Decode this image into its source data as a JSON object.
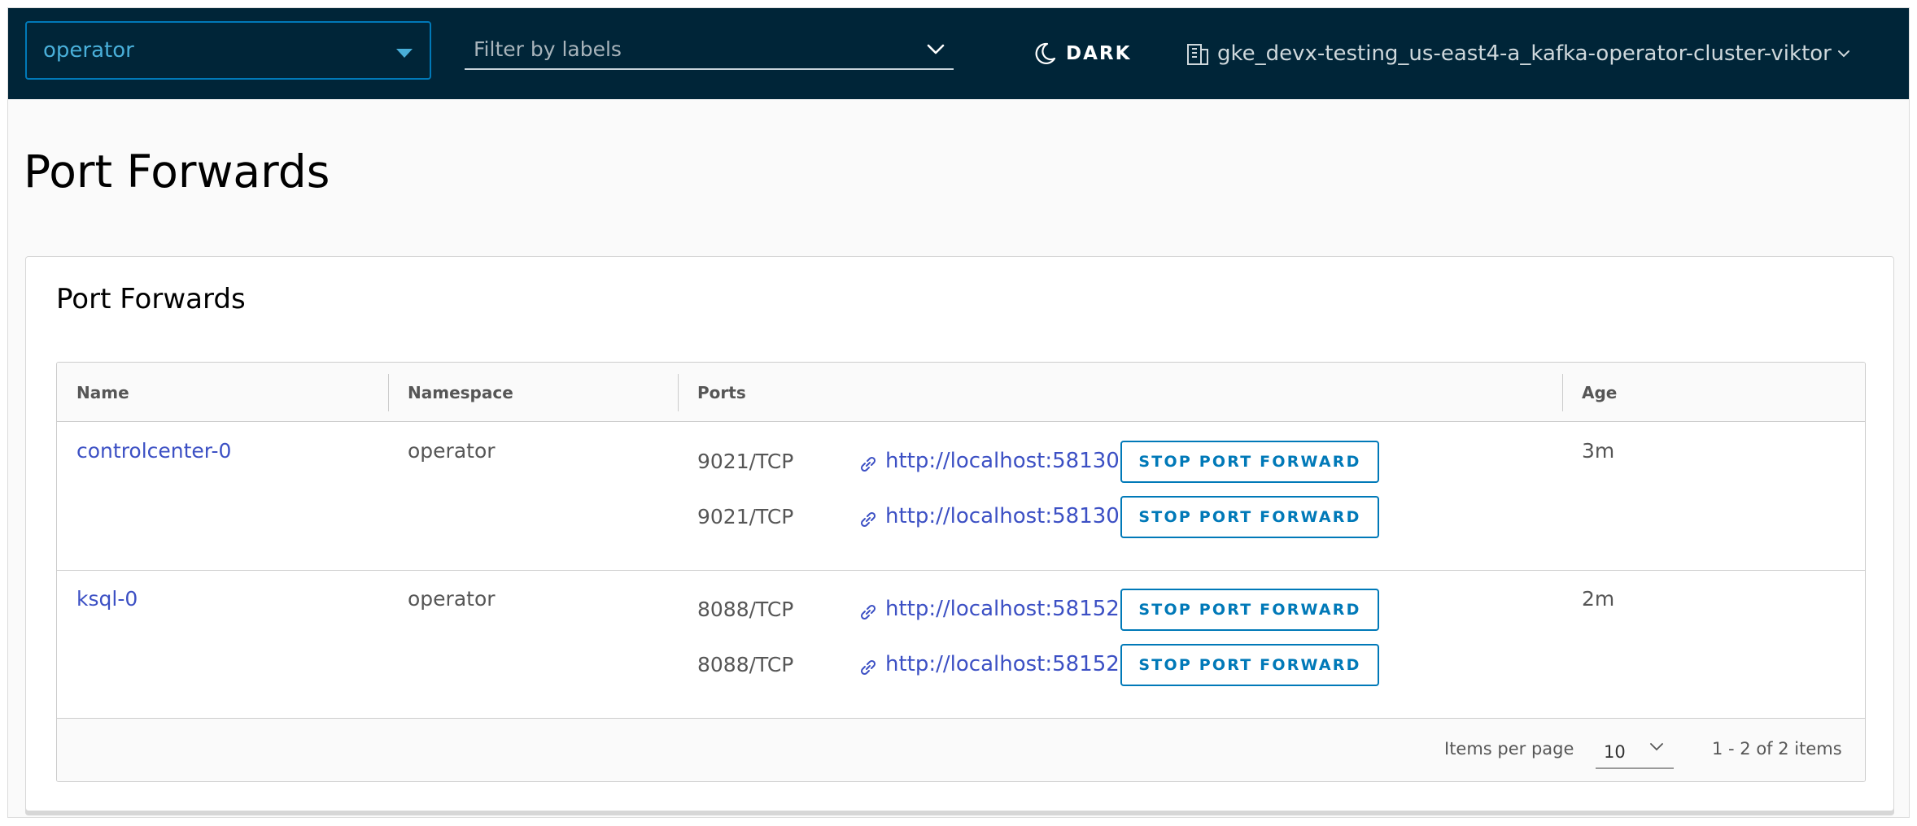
{
  "header": {
    "namespace_value": "operator",
    "label_filter_placeholder": "Filter by labels",
    "theme_toggle_label": "DARK",
    "context_name": "gke_devx-testing_us-east4-a_kafka-operator-cluster-viktor"
  },
  "page": {
    "title": "Port Forwards"
  },
  "card": {
    "title": "Port Forwards",
    "columns": [
      "Name",
      "Namespace",
      "Ports",
      "Age"
    ],
    "rows": [
      {
        "name": "controlcenter-0",
        "namespace": "operator",
        "age": "3m",
        "ports": [
          {
            "port": "9021/TCP",
            "url": "http://localhost:58130",
            "action": "STOP PORT FORWARD"
          },
          {
            "port": "9021/TCP",
            "url": "http://localhost:58130",
            "action": "STOP PORT FORWARD"
          }
        ]
      },
      {
        "name": "ksql-0",
        "namespace": "operator",
        "age": "2m",
        "ports": [
          {
            "port": "8088/TCP",
            "url": "http://localhost:58152",
            "action": "STOP PORT FORWARD"
          },
          {
            "port": "8088/TCP",
            "url": "http://localhost:58152",
            "action": "STOP PORT FORWARD"
          }
        ]
      }
    ],
    "footer": {
      "items_per_page_label": "Items per page",
      "items_per_page_value": "10",
      "range_text": "1 - 2 of 2 items"
    }
  },
  "colors": {
    "header_bg": "#002538",
    "accent": "#0079b8",
    "link": "#3c50c4"
  }
}
